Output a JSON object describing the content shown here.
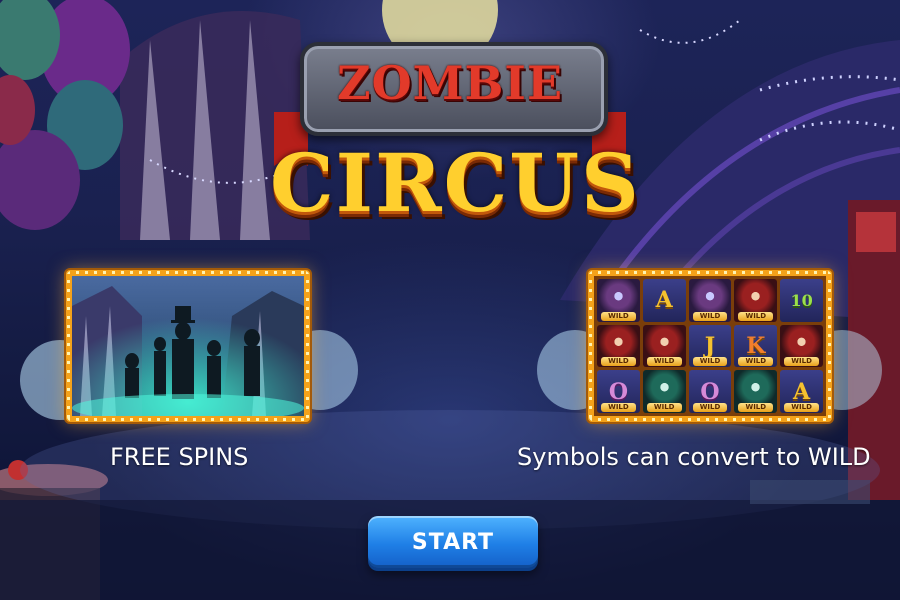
{
  "game": {
    "logo_top": "ZOMBIE",
    "logo_bottom": "CIRCUS"
  },
  "features": [
    {
      "caption": "FREE SPINS",
      "image": "free-spins-zombie-silhouettes"
    },
    {
      "caption": "Symbols can convert to WILD",
      "image": "reel-grid-with-wild-symbols",
      "grid": [
        [
          "joker-wild",
          "A",
          "joker-wild",
          "ringmaster-wild",
          "10"
        ],
        [
          "ringmaster-wild",
          "ringmaster-wild",
          "J-wild",
          "K-wild",
          "ringmaster-wild"
        ],
        [
          "O-wild",
          "joker-wild",
          "O-wild",
          "joker-wild",
          "A-wild"
        ]
      ],
      "wild_label": "WILD",
      "symbols": [
        [
          "",
          "A",
          "",
          "",
          "10"
        ],
        [
          "",
          "",
          "J",
          "K",
          ""
        ],
        [
          "O",
          "",
          "O",
          "",
          "A"
        ]
      ]
    }
  ],
  "start_button": {
    "label": "START"
  },
  "colors": {
    "accent_button": "#1f7fe6",
    "logo_gold": "#ffcf2e",
    "logo_red": "#e23a2a",
    "frame_gold": "#f4a21a",
    "background": "#1a2150"
  }
}
